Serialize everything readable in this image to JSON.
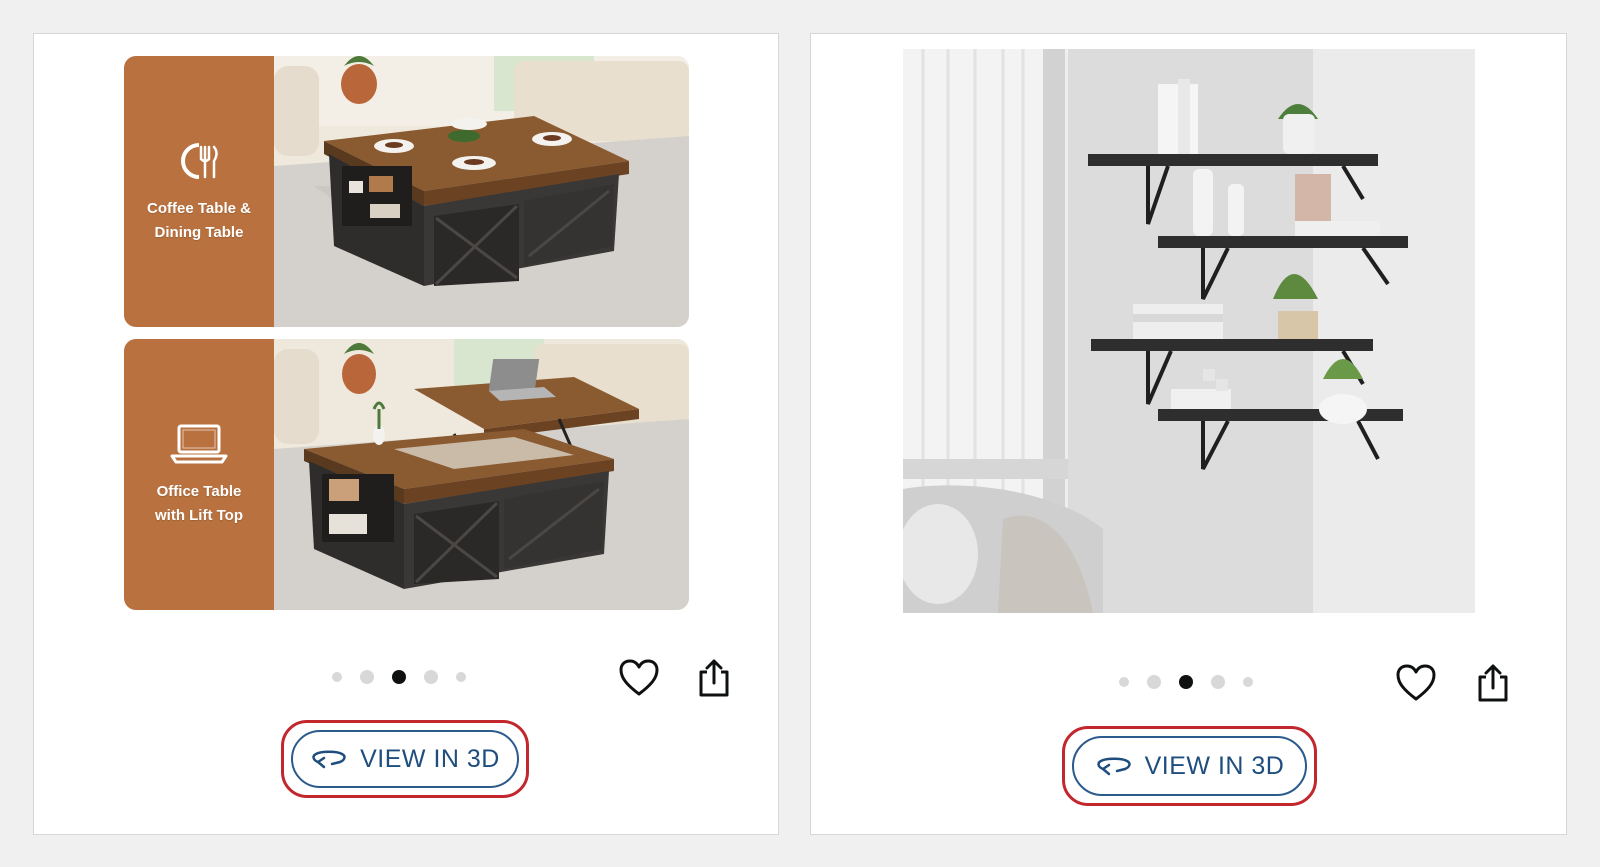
{
  "products": [
    {
      "panels": [
        {
          "label_lines": [
            "Coffee Table &",
            "Dining Table"
          ],
          "icon": "utensils-icon"
        },
        {
          "label_lines": [
            "Office Table",
            "with Lift Top"
          ],
          "icon": "laptop-icon"
        }
      ],
      "carousel": {
        "count": 5,
        "active_index": 2
      },
      "wishlist_icon": "heart-icon",
      "share_icon": "share-icon",
      "view3d": {
        "label": "VIEW IN 3D",
        "icon": "rotate-3d-icon"
      }
    },
    {
      "carousel": {
        "count": 5,
        "active_index": 2
      },
      "wishlist_icon": "heart-icon",
      "share_icon": "share-icon",
      "view3d": {
        "label": "VIEW IN 3D",
        "icon": "rotate-3d-icon"
      }
    }
  ],
  "colors": {
    "panel_label_bg": "#b8713f",
    "button_text": "#1f4e7e",
    "highlight_outline": "#c1272d",
    "active_dot": "#0f1111"
  }
}
